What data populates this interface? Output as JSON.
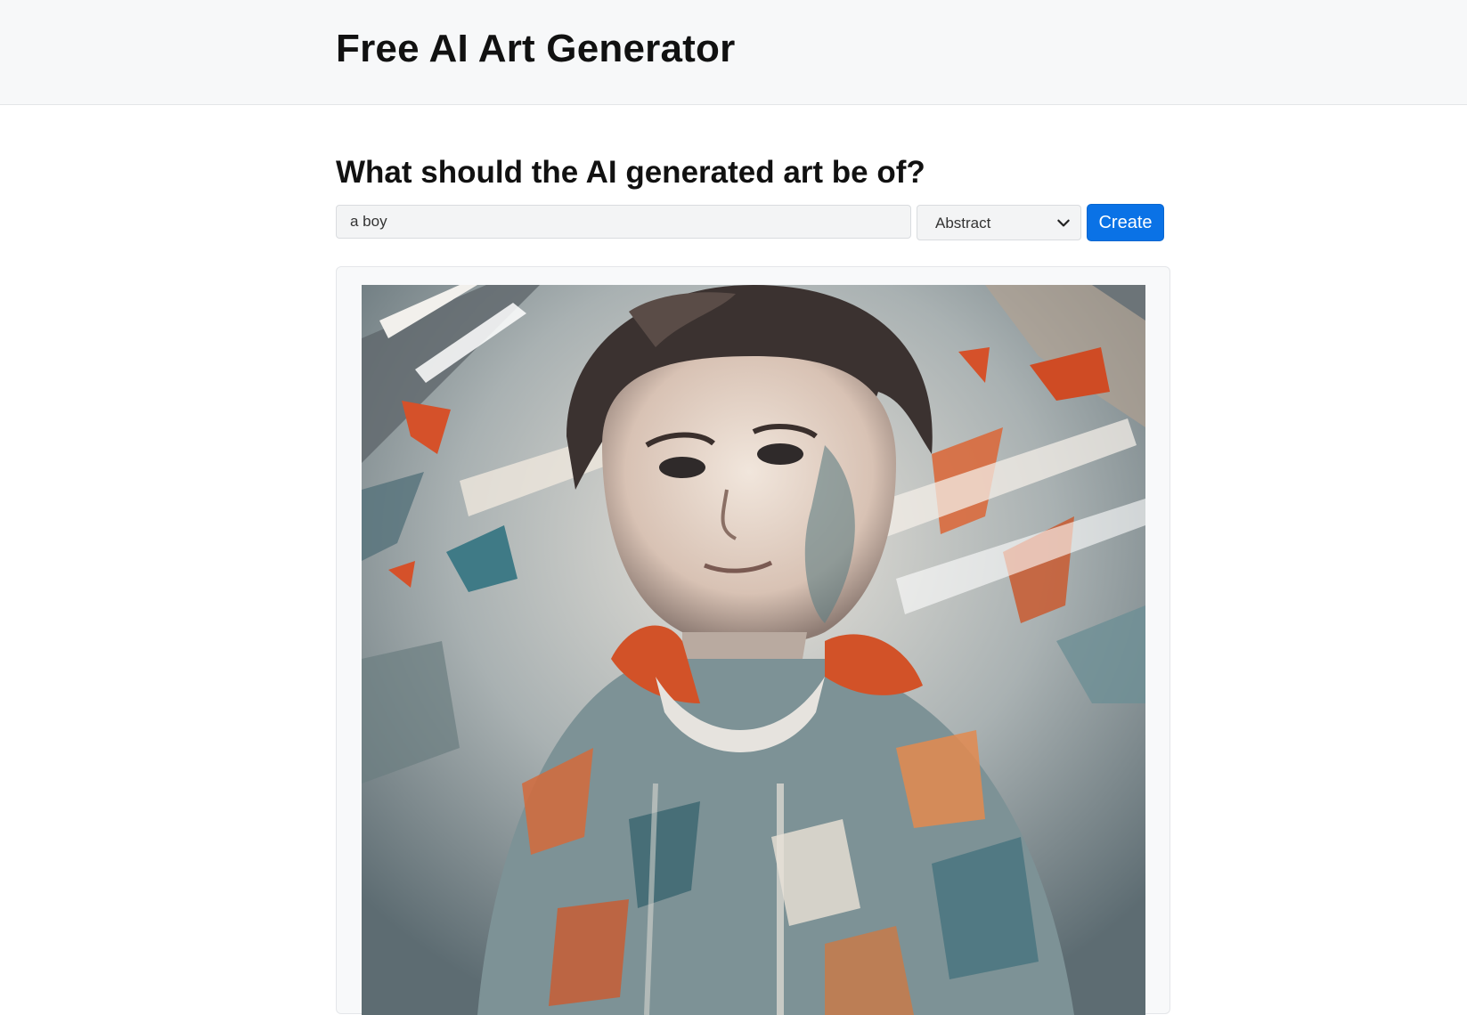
{
  "header": {
    "title": "Free AI Art Generator"
  },
  "form": {
    "heading": "What should the AI generated art be of?",
    "prompt_value": "a boy",
    "style_selected": "Abstract",
    "create_label": "Create"
  },
  "result": {
    "image_icon": "generated-abstract-portrait"
  },
  "colors": {
    "topbar_bg": "#f7f8f9",
    "primary": "#0a72e6",
    "art_orange": "#d5512a",
    "art_teal": "#3f6f7a",
    "art_cream": "#e8ddd0"
  }
}
